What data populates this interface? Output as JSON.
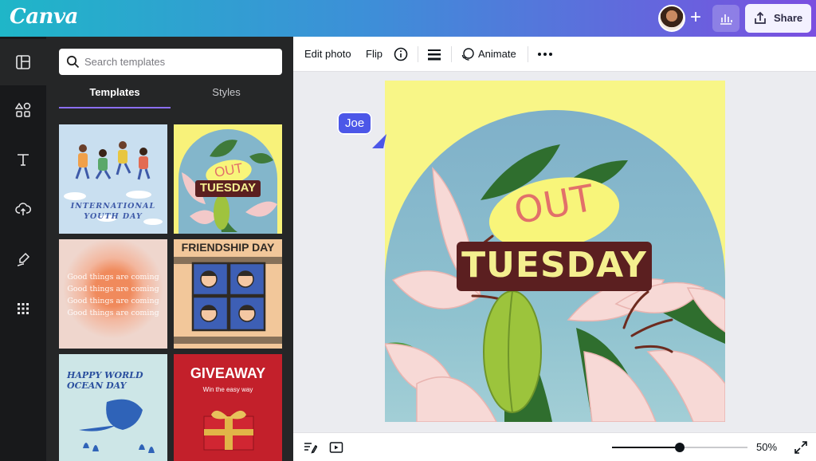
{
  "app": {
    "logo": "Canva"
  },
  "header": {
    "share_label": "Share"
  },
  "sidebar": {
    "search_placeholder": "Search templates",
    "tabs": [
      {
        "label": "Templates"
      },
      {
        "label": "Styles"
      }
    ],
    "rail_icons": [
      "layout-icon",
      "elements-icon",
      "text-icon",
      "upload-icon",
      "draw-icon",
      "apps-icon"
    ],
    "templates": [
      {
        "lines": [
          "International",
          "Youth Day"
        ]
      },
      {
        "top": "OUT",
        "bottom": "TUESDAY"
      },
      {
        "lines": [
          "Good things are coming",
          "Good things are coming",
          "Good things are coming",
          "Good things are coming"
        ]
      },
      {
        "lines": [
          "FRIENDSHIP DAY"
        ]
      },
      {
        "lines": [
          "HAPPY WORLD",
          "OCEAN DAY"
        ]
      },
      {
        "title": "GIVEAWAY",
        "subtitle": "Win the easy way"
      }
    ]
  },
  "toolbar": {
    "edit_photo": "Edit photo",
    "flip": "Flip",
    "animate": "Animate"
  },
  "design": {
    "top_text": "OUT",
    "bottom_text": "TUESDAY"
  },
  "collaborator": {
    "name": "Joe"
  },
  "footer": {
    "zoom": "50%",
    "zoom_fraction": 0.5
  },
  "colors": {
    "accent": "#8b6ef2",
    "collab": "#4c57e8",
    "dark_panel": "#252627"
  }
}
